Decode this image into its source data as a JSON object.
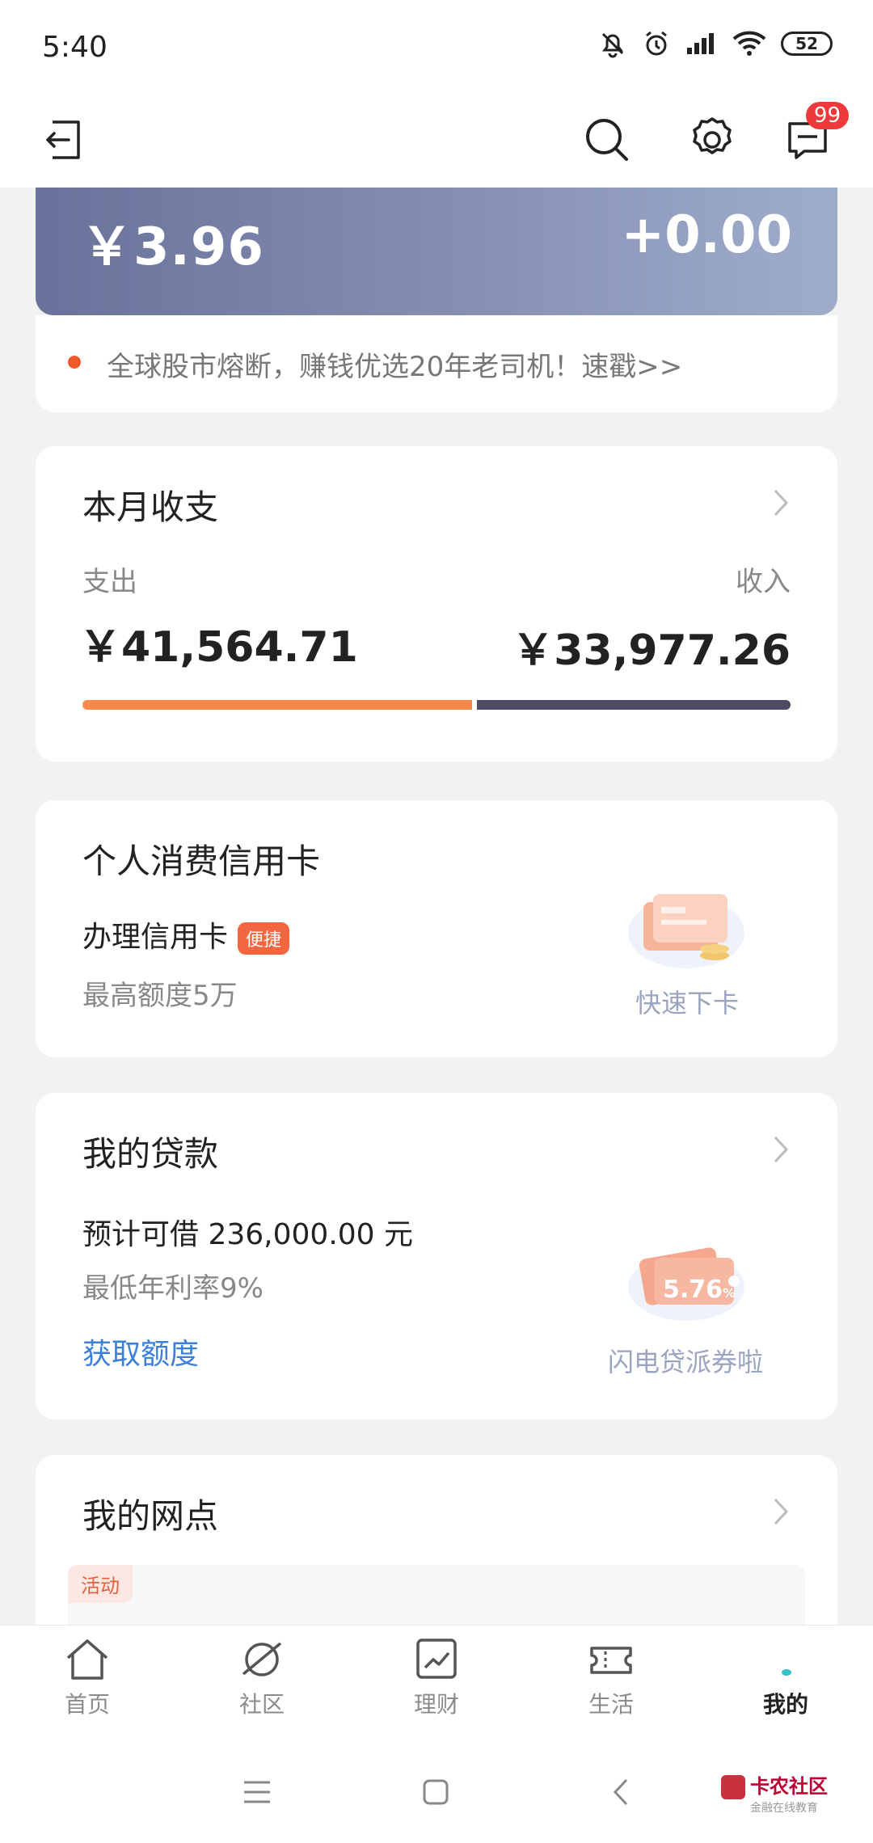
{
  "status": {
    "time": "5:40",
    "battery": "52"
  },
  "header": {
    "message_count": "99"
  },
  "asset": {
    "total": "￥3.96",
    "change": "+0.00"
  },
  "notice": {
    "text": "全球股市熔断，赚钱优选20年老司机！速戳>>"
  },
  "monthly": {
    "title": "本月收支",
    "expense_label": "支出",
    "income_label": "收入",
    "expense_value": "￥41,564.71",
    "income_value": "￥33,977.26",
    "expense_share": 0.55
  },
  "credit": {
    "title": "个人消费信用卡",
    "apply_label": "办理信用卡",
    "badge": "便捷",
    "limit": "最高额度5万",
    "promo": "快速下卡"
  },
  "loan": {
    "title": "我的贷款",
    "estimate": "预计可借 236,000.00 元",
    "rate": "最低年利率9%",
    "cta": "获取额度",
    "coupon_value": "5.76",
    "coupon_unit": "%",
    "promo": "闪电贷派券啦"
  },
  "branch": {
    "title": "我的网点",
    "tag": "活动"
  },
  "tabs": [
    {
      "label": "首页",
      "icon": "home-icon"
    },
    {
      "label": "社区",
      "icon": "planet-icon"
    },
    {
      "label": "理财",
      "icon": "chart-icon"
    },
    {
      "label": "生活",
      "icon": "ticket-icon"
    },
    {
      "label": "我的",
      "icon": "profile-icon"
    }
  ],
  "watermark": {
    "title": "卡农社区",
    "subtitle": "金融在线教育"
  },
  "colors": {
    "accent_orange": "#f26640",
    "bar_orange": "#f8894a",
    "bar_navy": "#4f4a63",
    "link_blue": "#3b7fd8"
  }
}
